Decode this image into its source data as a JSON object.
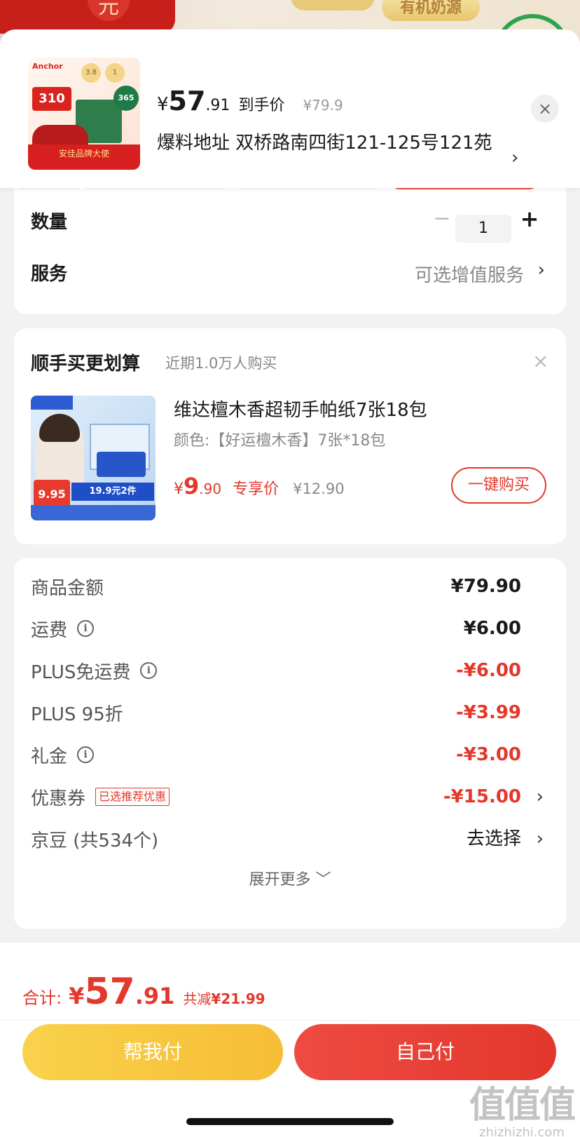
{
  "background": {
    "circle_text": "元",
    "pill_text": "有机奶源"
  },
  "product": {
    "thumb": {
      "logo": "Anchor",
      "price_badge": "310",
      "badge_1": "3.8",
      "badge_2": "1",
      "badge_365": "365",
      "band_text": "安佳品牌大使"
    },
    "price_yen": "¥",
    "price_int": "57",
    "price_dec": ".91",
    "price_tag": "到手价",
    "orig_price": "¥79.9",
    "address": "爆料地址  双桥路南四街121-125号121苑",
    "address_arrow": "›",
    "close": "×"
  },
  "options": {
    "qty_label": "数量",
    "qty_minus": "−",
    "qty_value": "1",
    "qty_plus": "+",
    "service_label": "服务",
    "service_value": "可选增值服务",
    "service_arrow": "›"
  },
  "upsell": {
    "title": "顺手买更划算",
    "subtitle": "近期1.0万人购买",
    "close": "×",
    "image": {
      "price_badge": "9.95",
      "band_text": "19.9元2件"
    },
    "name": "维达檀木香超韧手帕纸7张18包",
    "spec": "颜色:【好运檀木香】7张*18包",
    "price_yen": "¥",
    "price_int": "9",
    "price_dec": ".90",
    "price_tag": "专享价",
    "orig_price": "¥12.90",
    "buy_label": "一键购买"
  },
  "summary": {
    "rows": [
      {
        "label": "商品金额",
        "value": "¥79.90"
      },
      {
        "label": "运费",
        "value": "¥6.00"
      },
      {
        "label": "PLUS免运费",
        "value": "-¥6.00"
      },
      {
        "label": "PLUS 95折",
        "value": "-¥3.99"
      },
      {
        "label": "礼金",
        "value": "-¥3.00"
      },
      {
        "label": "优惠券",
        "tag": "已选推荐优惠",
        "value": "-¥15.00"
      },
      {
        "label": "京豆 (共534个)",
        "value": "去选择"
      }
    ],
    "info_glyph": "i",
    "arrow": "›",
    "expand_label": "展开更多 ﹀"
  },
  "footer": {
    "total_label": "合计:",
    "total_yen": "¥",
    "total_int": "57",
    "total_dec": ".91",
    "saved_prefix": "共减",
    "saved_value": "¥21.99",
    "help_pay_label": "帮我付",
    "self_pay_label": "自己付"
  },
  "watermark": {
    "big": "值值值",
    "small": "zhizhizhi.com"
  },
  "colors": {
    "accent_red": "#e3382b",
    "gold_button": "#f6bd35",
    "red_button": "#e2372c"
  },
  "icons": [
    "close-icon",
    "chevron-right-icon",
    "minus-icon",
    "plus-icon",
    "info-icon",
    "chevron-down-icon"
  ]
}
